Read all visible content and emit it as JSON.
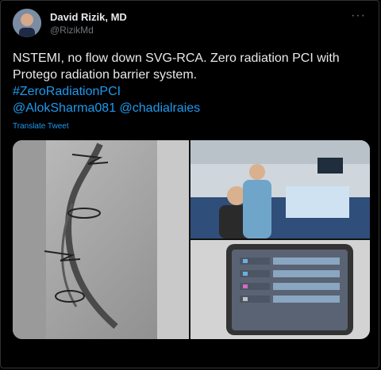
{
  "tweet": {
    "author_name": "David Rizik, MD",
    "author_handle": "@RizikMd",
    "more_icon": "more-icon",
    "line1": "NSTEMI, no flow down SVG-RCA. Zero radiation PCI with Protego radiation barrier system.",
    "hashtag": "#ZeroRadiationPCI",
    "mentions": "@AlokSharma081 @chadialraies",
    "translate_label": "Translate Tweet"
  },
  "colors": {
    "background": "#000000",
    "text": "#e7e9ea",
    "muted": "#71767b",
    "link": "#1d9bf0"
  }
}
